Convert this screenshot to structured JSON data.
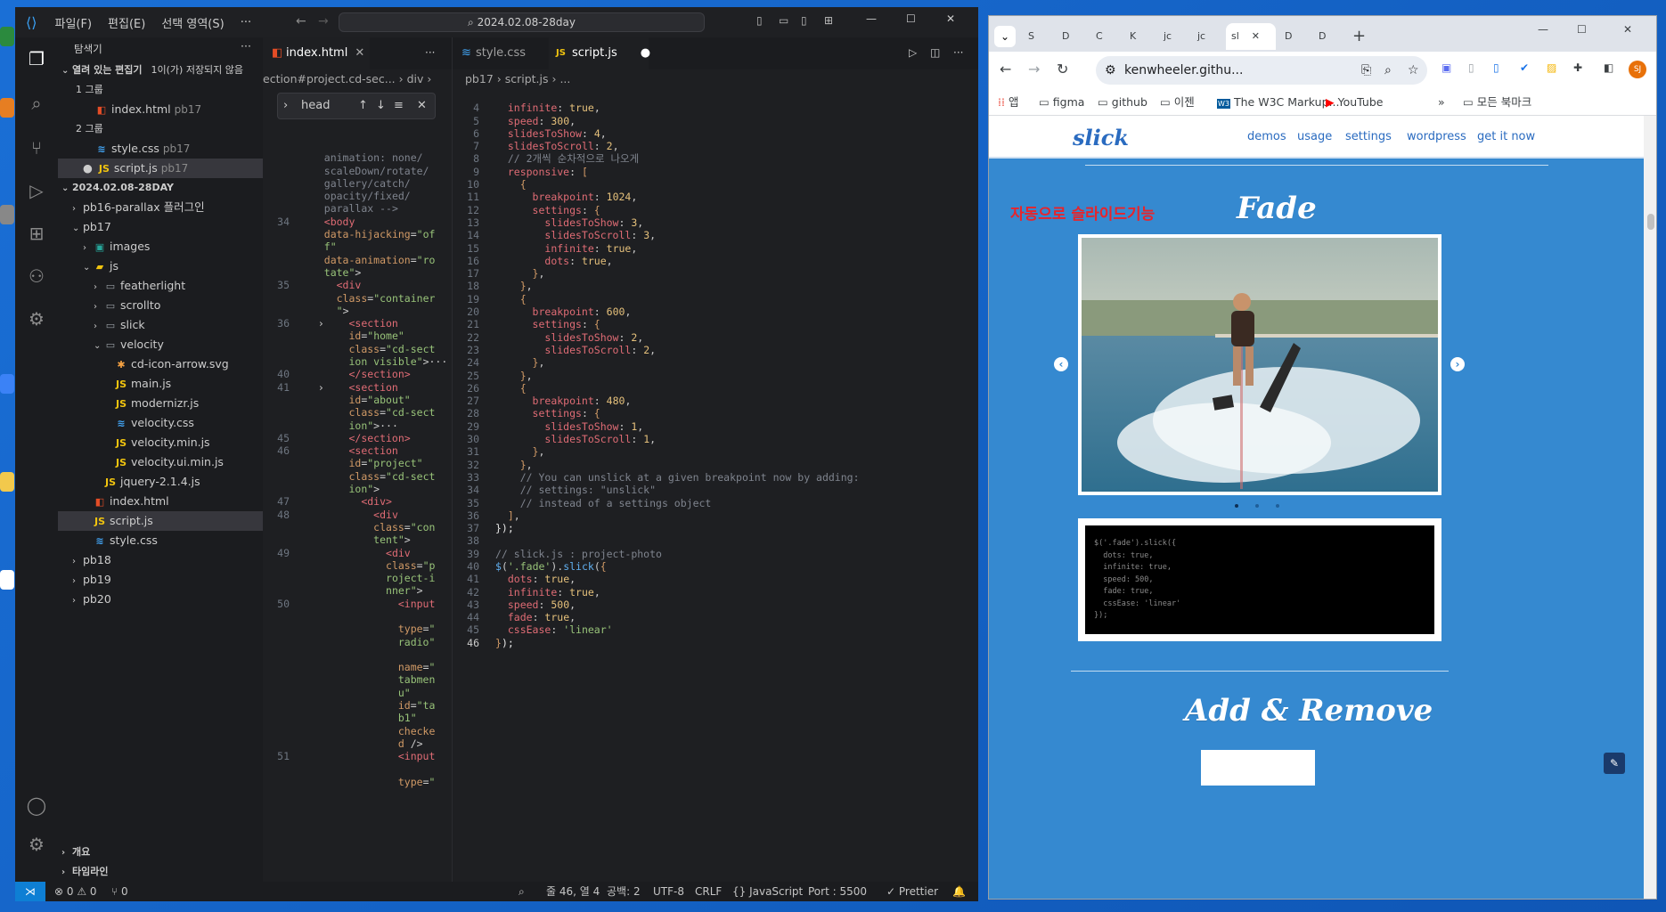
{
  "vscode": {
    "menu": [
      "파일(F)",
      "편집(E)",
      "선택 영역(S)",
      "···"
    ],
    "search": "2024.02.08-28day",
    "explorer_title": "탐색기",
    "open_editors_label": "열려 있는 편집기",
    "unsaved_badge": "1이(가) 저장되지 않음",
    "group1": "1 그룹",
    "group2": "2 그룹",
    "open_files": [
      {
        "name": "index.html",
        "dir": "pb17"
      },
      {
        "name": "style.css",
        "dir": "pb17"
      },
      {
        "name": "script.js",
        "dir": "pb17"
      }
    ],
    "workspace": "2024.02.08-28DAY",
    "tree": [
      "pb16-parallax 플러그인",
      "pb17",
      "images",
      "js",
      "featherlight",
      "scrollto",
      "slick",
      "velocity",
      "cd-icon-arrow.svg",
      "main.js",
      "modernizr.js",
      "velocity.css",
      "velocity.min.js",
      "velocity.ui.min.js",
      "jquery-2.1.4.js",
      "index.html",
      "script.js",
      "style.css",
      "pb18",
      "pb19",
      "pb20"
    ],
    "outline": "개요",
    "timeline": "타임라인",
    "tab1": "index.html",
    "tab2": "style.css",
    "tab3": "script.js",
    "crumbs1": "ection#project.cd-sec... › div › ",
    "crumbs2": "pb17 › script.js › ...",
    "find_text": "head",
    "status": {
      "problems": "⊗ 0 ⚠ 0",
      "ports": "⑂ 0",
      "position": "줄 46, 열 4",
      "spaces": "공백: 2",
      "encoding": "UTF-8",
      "eol": "CRLF",
      "lang": "{} JavaScript",
      "port": "Port : 5500",
      "prettier": "✓ Prettier"
    }
  },
  "chrome": {
    "url": "kenwheeler.githu...",
    "tab_letters": [
      "S",
      "D",
      "C",
      "K",
      "jc",
      "jc",
      "sl",
      "D",
      "D"
    ],
    "bookmarks": [
      "앱",
      "figma",
      "github",
      "이젠",
      "The W3C Markup...",
      "YouTube",
      "모든 북마크"
    ],
    "avatar": "SJ",
    "site": {
      "logo": "slick",
      "nav": [
        "demos",
        "usage",
        "settings",
        "wordpress",
        "get it now"
      ],
      "annotation": "자동으로 슬라이드기능",
      "title1": "Fade",
      "title2": "Add & Remove",
      "code_lines": [
        "$('.fade').slick({",
        "  dots: true,",
        "  infinite: true,",
        "  speed: 500,",
        "  fade: true,",
        "  cssEase: 'linear'",
        "});"
      ]
    }
  },
  "colors": {
    "accent": "#0e7fd4",
    "site_bg": "#3589d0",
    "red_note": "#e8242b"
  }
}
